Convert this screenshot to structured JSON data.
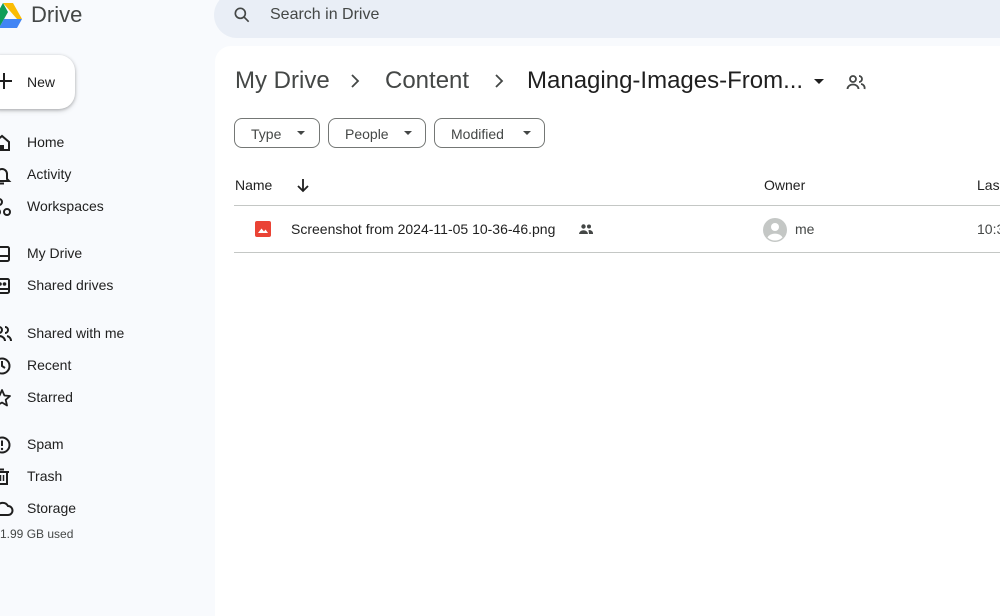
{
  "app": {
    "name": "Drive"
  },
  "search": {
    "placeholder": "Search in Drive"
  },
  "new_button": {
    "label": "New"
  },
  "sidebar": {
    "items": [
      {
        "label": "Home",
        "icon": "home-icon"
      },
      {
        "label": "Activity",
        "icon": "bell-icon"
      },
      {
        "label": "Workspaces",
        "icon": "workspaces-icon"
      },
      {
        "label": "My Drive",
        "icon": "my-drive-icon"
      },
      {
        "label": "Shared drives",
        "icon": "shared-drives-icon"
      },
      {
        "label": "Shared with me",
        "icon": "people-icon"
      },
      {
        "label": "Recent",
        "icon": "clock-icon"
      },
      {
        "label": "Starred",
        "icon": "star-icon"
      },
      {
        "label": "Spam",
        "icon": "spam-icon"
      },
      {
        "label": "Trash",
        "icon": "trash-icon"
      },
      {
        "label": "Storage",
        "icon": "cloud-icon"
      }
    ],
    "storage_used": "1.99 GB used"
  },
  "breadcrumb": {
    "items": [
      "My Drive",
      "Content",
      "Managing-Images-From..."
    ]
  },
  "filters": [
    "Type",
    "People",
    "Modified"
  ],
  "table": {
    "columns": {
      "name": "Name",
      "owner": "Owner",
      "modified": "Las"
    },
    "rows": [
      {
        "name": "Screenshot from 2024-11-05 10-36-46.png",
        "owner": "me",
        "modified": "10:3"
      }
    ]
  },
  "colors": {
    "accent": "#0b57d0",
    "image_file": "#ea4335",
    "background": "#f8fafd"
  }
}
